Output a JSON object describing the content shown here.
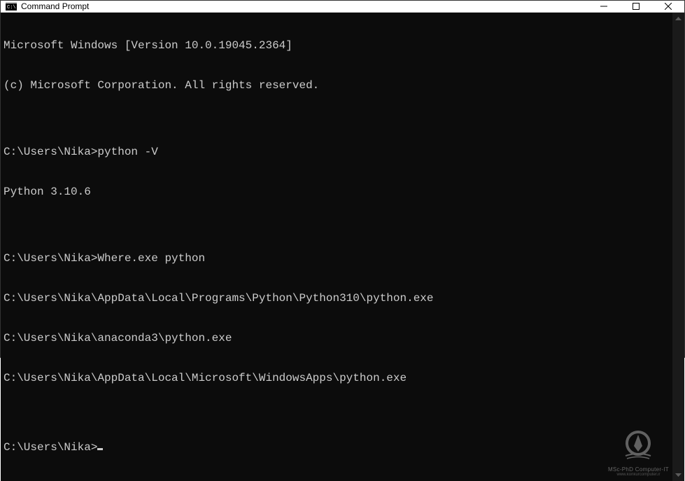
{
  "titlebar": {
    "title": "Command Prompt"
  },
  "terminal": {
    "line1": "Microsoft Windows [Version 10.0.19045.2364]",
    "line2": "(c) Microsoft Corporation. All rights reserved.",
    "blank1": "",
    "prompt1": "C:\\Users\\Nika>python -V",
    "output1": "Python 3.10.6",
    "blank2": "",
    "prompt2": "C:\\Users\\Nika>Where.exe python",
    "output2a": "C:\\Users\\Nika\\AppData\\Local\\Programs\\Python\\Python310\\python.exe",
    "output2b": "C:\\Users\\Nika\\anaconda3\\python.exe",
    "output2c": "C:\\Users\\Nika\\AppData\\Local\\Microsoft\\WindowsApps\\python.exe",
    "blank3": "",
    "prompt3": "C:\\Users\\Nika>"
  },
  "watermark": {
    "text": "MSc-PhD Computer-IT",
    "url": "www.konkurcomputer.ir"
  }
}
